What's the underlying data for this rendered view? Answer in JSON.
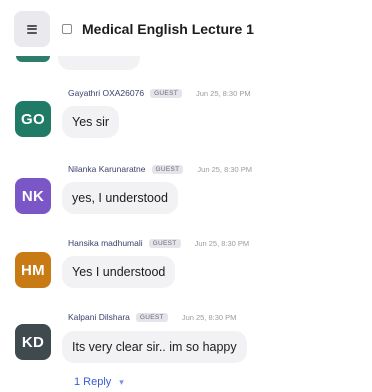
{
  "header": {
    "title": "Medical English Lecture 1"
  },
  "messages": [
    {
      "initials": "GO",
      "name": "Gayathri OXA26076",
      "badge": "GUEST",
      "time": "Jun 25, 8:30 PM",
      "text": "Yes sir",
      "avatar_color": "#1f7a66"
    },
    {
      "initials": "NK",
      "name": "Nilanka Karunaratne",
      "badge": "GUEST",
      "time": "Jun 25, 8:30 PM",
      "text": "yes, I understood",
      "avatar_color": "#7b56c6"
    },
    {
      "initials": "HM",
      "name": "Hansika madhumali",
      "badge": "GUEST",
      "time": "Jun 25, 8:30 PM",
      "text": "Yes I understood",
      "avatar_color": "#c87a14"
    },
    {
      "initials": "KD",
      "name": "Kalpani Dilshara",
      "badge": "GUEST",
      "time": "Jun 25, 8:30 PM",
      "text": "Its very clear sir.. im so happy",
      "avatar_color": "#3f4a4f"
    }
  ],
  "thread": {
    "reply_label": "1 Reply",
    "chevron": "▾"
  },
  "icons": {
    "menu": "hamburger-menu-icon",
    "channel": "channel-square-icon",
    "chevron": "chevron-down-icon"
  }
}
